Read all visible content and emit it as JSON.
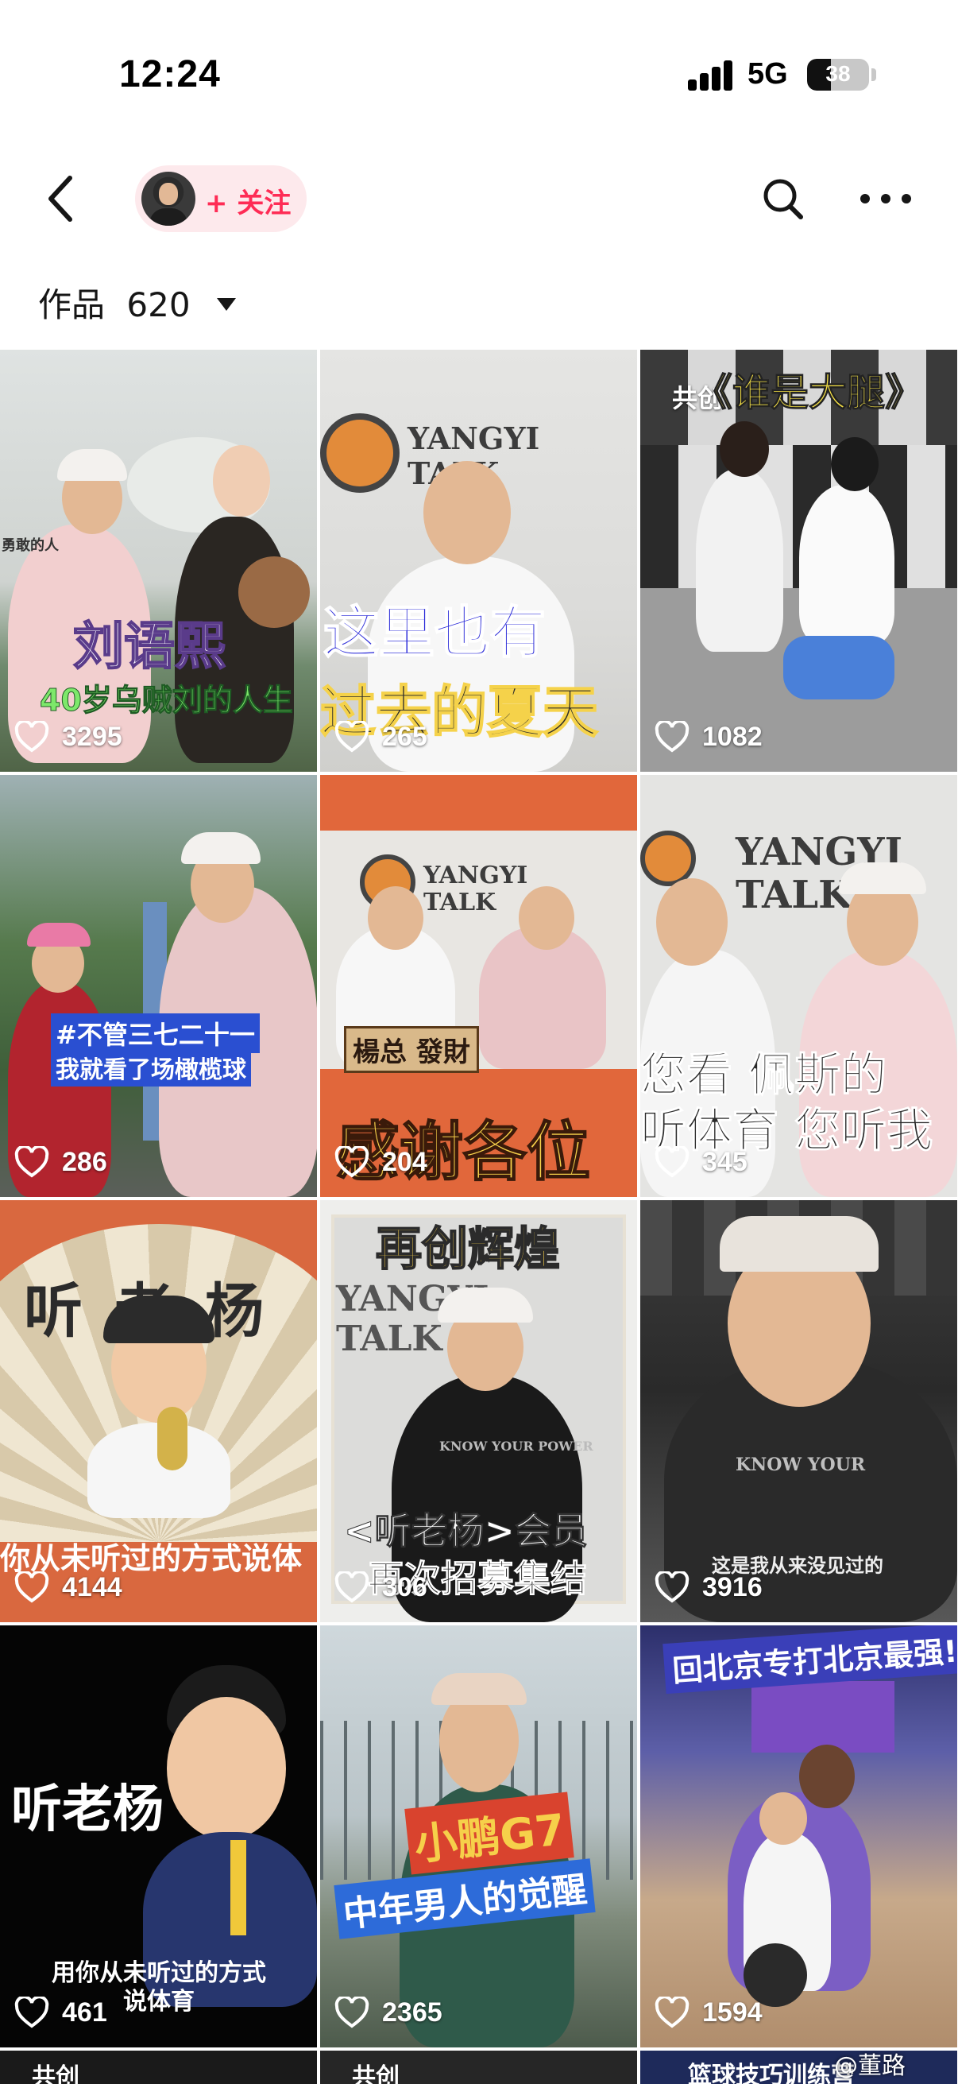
{
  "status_bar": {
    "time": "12:24",
    "network": "5G",
    "battery": "38",
    "battery_level": 0.38
  },
  "nav": {
    "follow_label": "+ 关注",
    "icons": [
      "back-arrow-icon",
      "search-icon",
      "more-icon"
    ]
  },
  "works": {
    "label": "作品",
    "count": "620"
  },
  "grid": [
    {
      "likes": "3295",
      "caption_main": "刘语熙",
      "caption_sub": "40岁乌贼刘的人生",
      "side_text": "勇敢的人"
    },
    {
      "likes": "265",
      "logo": "YANGYI TALK",
      "caption_main": "这里也有",
      "caption_sub": "过去的夏天"
    },
    {
      "likes": "1082",
      "badge": "共创",
      "caption_main": "《谁是大腿》"
    },
    {
      "likes": "286",
      "caption_main": "#不管三七二十一",
      "caption_sub": "我就看了场橄榄球"
    },
    {
      "likes": "204",
      "logo": "YANGYI TALK",
      "sign": "楊总 發財",
      "caption_main": "感谢各位"
    },
    {
      "likes": "345",
      "logo": "YANGYI TALK",
      "caption_main": "您看 佩斯的",
      "caption_sub": "听体育 您听我"
    },
    {
      "likes": "4144",
      "caption_main": "听老杨",
      "caption_sub": "你从未听过的方式说体"
    },
    {
      "likes": "306",
      "caption_top": "再创辉煌",
      "logo": "YANGYI TALK",
      "shirt_text": "KNOW YOUR POWER",
      "caption_main": "<听老杨>会员",
      "caption_sub": "再次招募集结"
    },
    {
      "likes": "3916",
      "shirt_text": "KNOW YOUR",
      "caption_sub": "这是我从来没见过的"
    },
    {
      "likes": "461",
      "caption_main": "听老杨",
      "caption_sub": "用你从未听过的方式说体育"
    },
    {
      "likes": "2365",
      "caption_main": "小鹏G7",
      "caption_sub": "中年男人的觉醒"
    },
    {
      "likes": "1594",
      "caption_main": "回北京专打北京最强!"
    }
  ],
  "partial_row": {
    "items": [
      "共创",
      "共创",
      "篮球技巧训练营"
    ]
  },
  "watermark": "@董路"
}
